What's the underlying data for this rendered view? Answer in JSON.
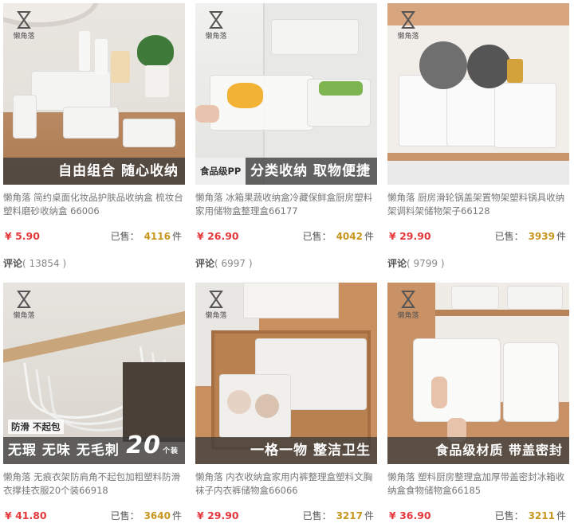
{
  "brand": "懒角落",
  "currency": "¥",
  "sold_label": "已售：",
  "unit": "件",
  "reviews_label": "评论",
  "colors": {
    "price": "#e4393c",
    "sold_count": "#c8961e",
    "banner_bg": "#3c3c3c"
  },
  "products": [
    {
      "banner": "自由组合 随心收纳",
      "badge": "",
      "title": "懒角落 简约桌面化妆品护肤品收纳盒 梳妆台塑料磨砂收纳盒 66006",
      "price": "5.90",
      "sold": "4116",
      "reviews": "13854"
    },
    {
      "banner": "分类收纳 取物便捷",
      "badge": "食品级PP",
      "title": "懒角落 冰箱果蔬收纳盒冷藏保鲜盒厨房塑料家用储物盒整理盒66177",
      "price": "26.90",
      "sold": "4042",
      "reviews": "6997"
    },
    {
      "banner": "",
      "badge": "",
      "title": "懒角落 厨房滑轮锅盖架置物架塑料锅具收纳架调料架储物架子66128",
      "price": "29.90",
      "sold": "3939",
      "reviews": "9799"
    },
    {
      "banner": "无瑕 无味 无毛刺",
      "badge": "防滑 不起包",
      "count": "20",
      "count_unit": "个装",
      "title": "懒角落 无痕衣架防肩角不起包加粗塑料防滑衣撑挂衣服20个装66918",
      "price": "41.80",
      "sold": "3640",
      "reviews": ""
    },
    {
      "banner": "一格一物 整洁卫生",
      "badge": "",
      "title": "懒角落 内衣收纳盒家用内裤整理盒塑料文胸袜子内衣裤储物盒66066",
      "price": "29.90",
      "sold": "3217",
      "reviews": ""
    },
    {
      "banner": "食品级材质 带盖密封",
      "badge": "",
      "title": "懒角落 塑料厨房整理盒加厚带盖密封冰箱收纳盒食物储物盒66185",
      "price": "36.90",
      "sold": "3211",
      "reviews": ""
    }
  ]
}
